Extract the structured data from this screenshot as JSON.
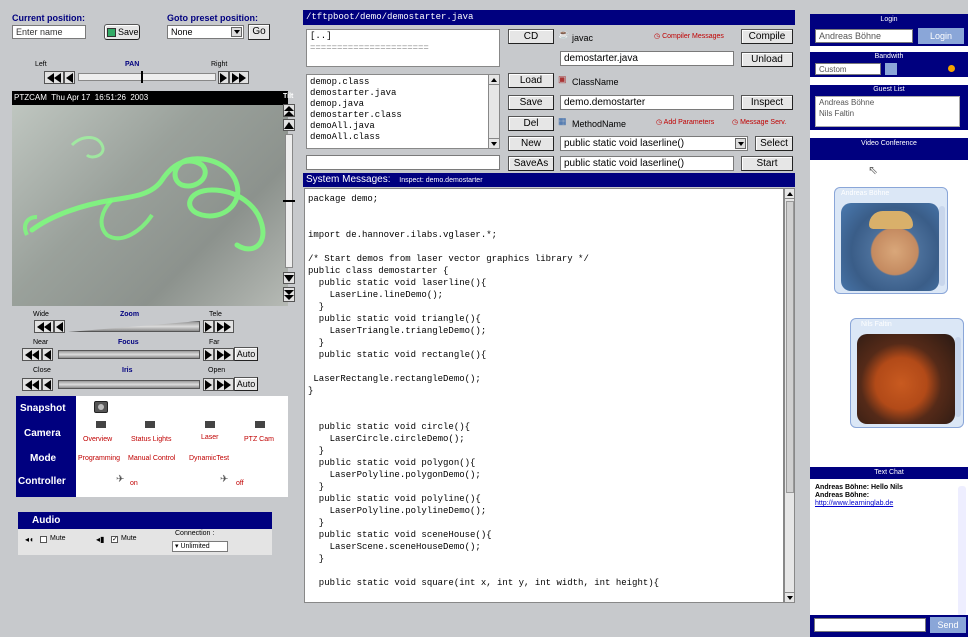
{
  "camera_controls": {
    "current_position_label": "Current position:",
    "current_position_placeholder": "Enter name",
    "save_label": "Save",
    "goto_preset_label": "Goto preset position:",
    "preset_value": "None",
    "go_label": "Go",
    "pan": {
      "left": "Left",
      "center": "PAN",
      "right": "Right"
    },
    "video_overlay": "PTZCAM  Thu Apr 17  16:51:26  2003",
    "tilt_label": "Tilt",
    "zoom": {
      "left": "Wide",
      "center": "Zoom",
      "right": "Tele"
    },
    "focus": {
      "left": "Near",
      "center": "Focus",
      "right": "Far",
      "auto": "Auto"
    },
    "iris": {
      "left": "Close",
      "center": "Iris",
      "right": "Open",
      "auto": "Auto"
    }
  },
  "control_panel": {
    "snapshot_label": "Snapshot",
    "camera_label": "Camera",
    "camera_items": [
      "Overview",
      "Status Lights",
      "Laser",
      "PTZ Cam"
    ],
    "mode_label": "Mode",
    "mode_items": [
      "Programming",
      "Manual Control",
      "DynamicTest"
    ],
    "controller_label": "Controller",
    "controller_on": "on",
    "controller_off": "off"
  },
  "audio": {
    "title": "Audio",
    "mute1": "Mute",
    "mute2": "Mute",
    "connection_label": "Connection :",
    "connection_value": "Unlimited"
  },
  "editor": {
    "path": "/tftpboot/demo/demostarter.java",
    "dir_up": "[..]",
    "dir_sep": "======================",
    "files": [
      "demop.class",
      "demostarter.java",
      "demop.java",
      "demostarter.class",
      "demoAll.java",
      "demoAll.class"
    ],
    "cd_label": "CD",
    "javac_label": "javac",
    "compiler_messages": "Compiler Messages",
    "compile_label": "Compile",
    "filename": "demostarter.java",
    "unload_label": "Unload",
    "load_label": "Load",
    "classname_label": "ClassName",
    "save_label": "Save",
    "classname_value": "demo.demostarter",
    "inspect_label": "Inspect",
    "del_label": "Del",
    "methodname_label": "MethodName",
    "add_parameters": "Add Parameters",
    "message_serv": "Message Serv.",
    "new_label": "New",
    "method_select": "public static void laserline()",
    "select_label": "Select",
    "saveas_label": "SaveAs",
    "method_value": "public static void laserline()",
    "start_label": "Start",
    "system_messages": "System Messages:",
    "system_message_text": "Inspect: demo.demostarter",
    "code": "package demo;\n\n\nimport de.hannover.ilabs.vglaser.*;\n\n/* Start demos from laser vector graphics library */\npublic class demostarter {\n  public static void laserline(){\n    LaserLine.lineDemo();\n  }\n  public static void triangle(){\n    LaserTriangle.triangleDemo();\n  }\n  public static void rectangle(){\n\n LaserRectangle.rectangleDemo();\n}\n\n\n  public static void circle(){\n    LaserCircle.circleDemo();\n  }\n  public static void polygon(){\n    LaserPolyline.polygonDemo();\n  }\n  public static void polyline(){\n    LaserPolyline.polylineDemo();\n  }\n  public static void sceneHouse(){\n    LaserScene.sceneHouseDemo();\n  }\n\n  public static void square(int x, int y, int width, int height){\n\n    PlotSystem.setSystem(new LaserSystem());"
  },
  "sidebar": {
    "login_title": "Login",
    "login_user": "Andreas Böhne",
    "login_button": "Login",
    "bandwidth_title": "Bandwith",
    "bandwidth_value": "Custom",
    "guest_list_title": "Guest List",
    "guests": [
      "Andreas Böhne",
      "Nils Faltin"
    ],
    "video_title": "Video Conference",
    "video1_name": "Andreas Böhne",
    "video2_name": "Nils Faltin",
    "chat_title": "Text Chat",
    "chat_lines": [
      "Andreas Böhne: Hello Nils",
      "Andreas Böhne:",
      "http://www.learninglab.de"
    ],
    "send_label": "Send"
  },
  "colors": {
    "navy": "#00007f",
    "accent_red": "#c00000",
    "laser_green": "#7cff7c"
  }
}
